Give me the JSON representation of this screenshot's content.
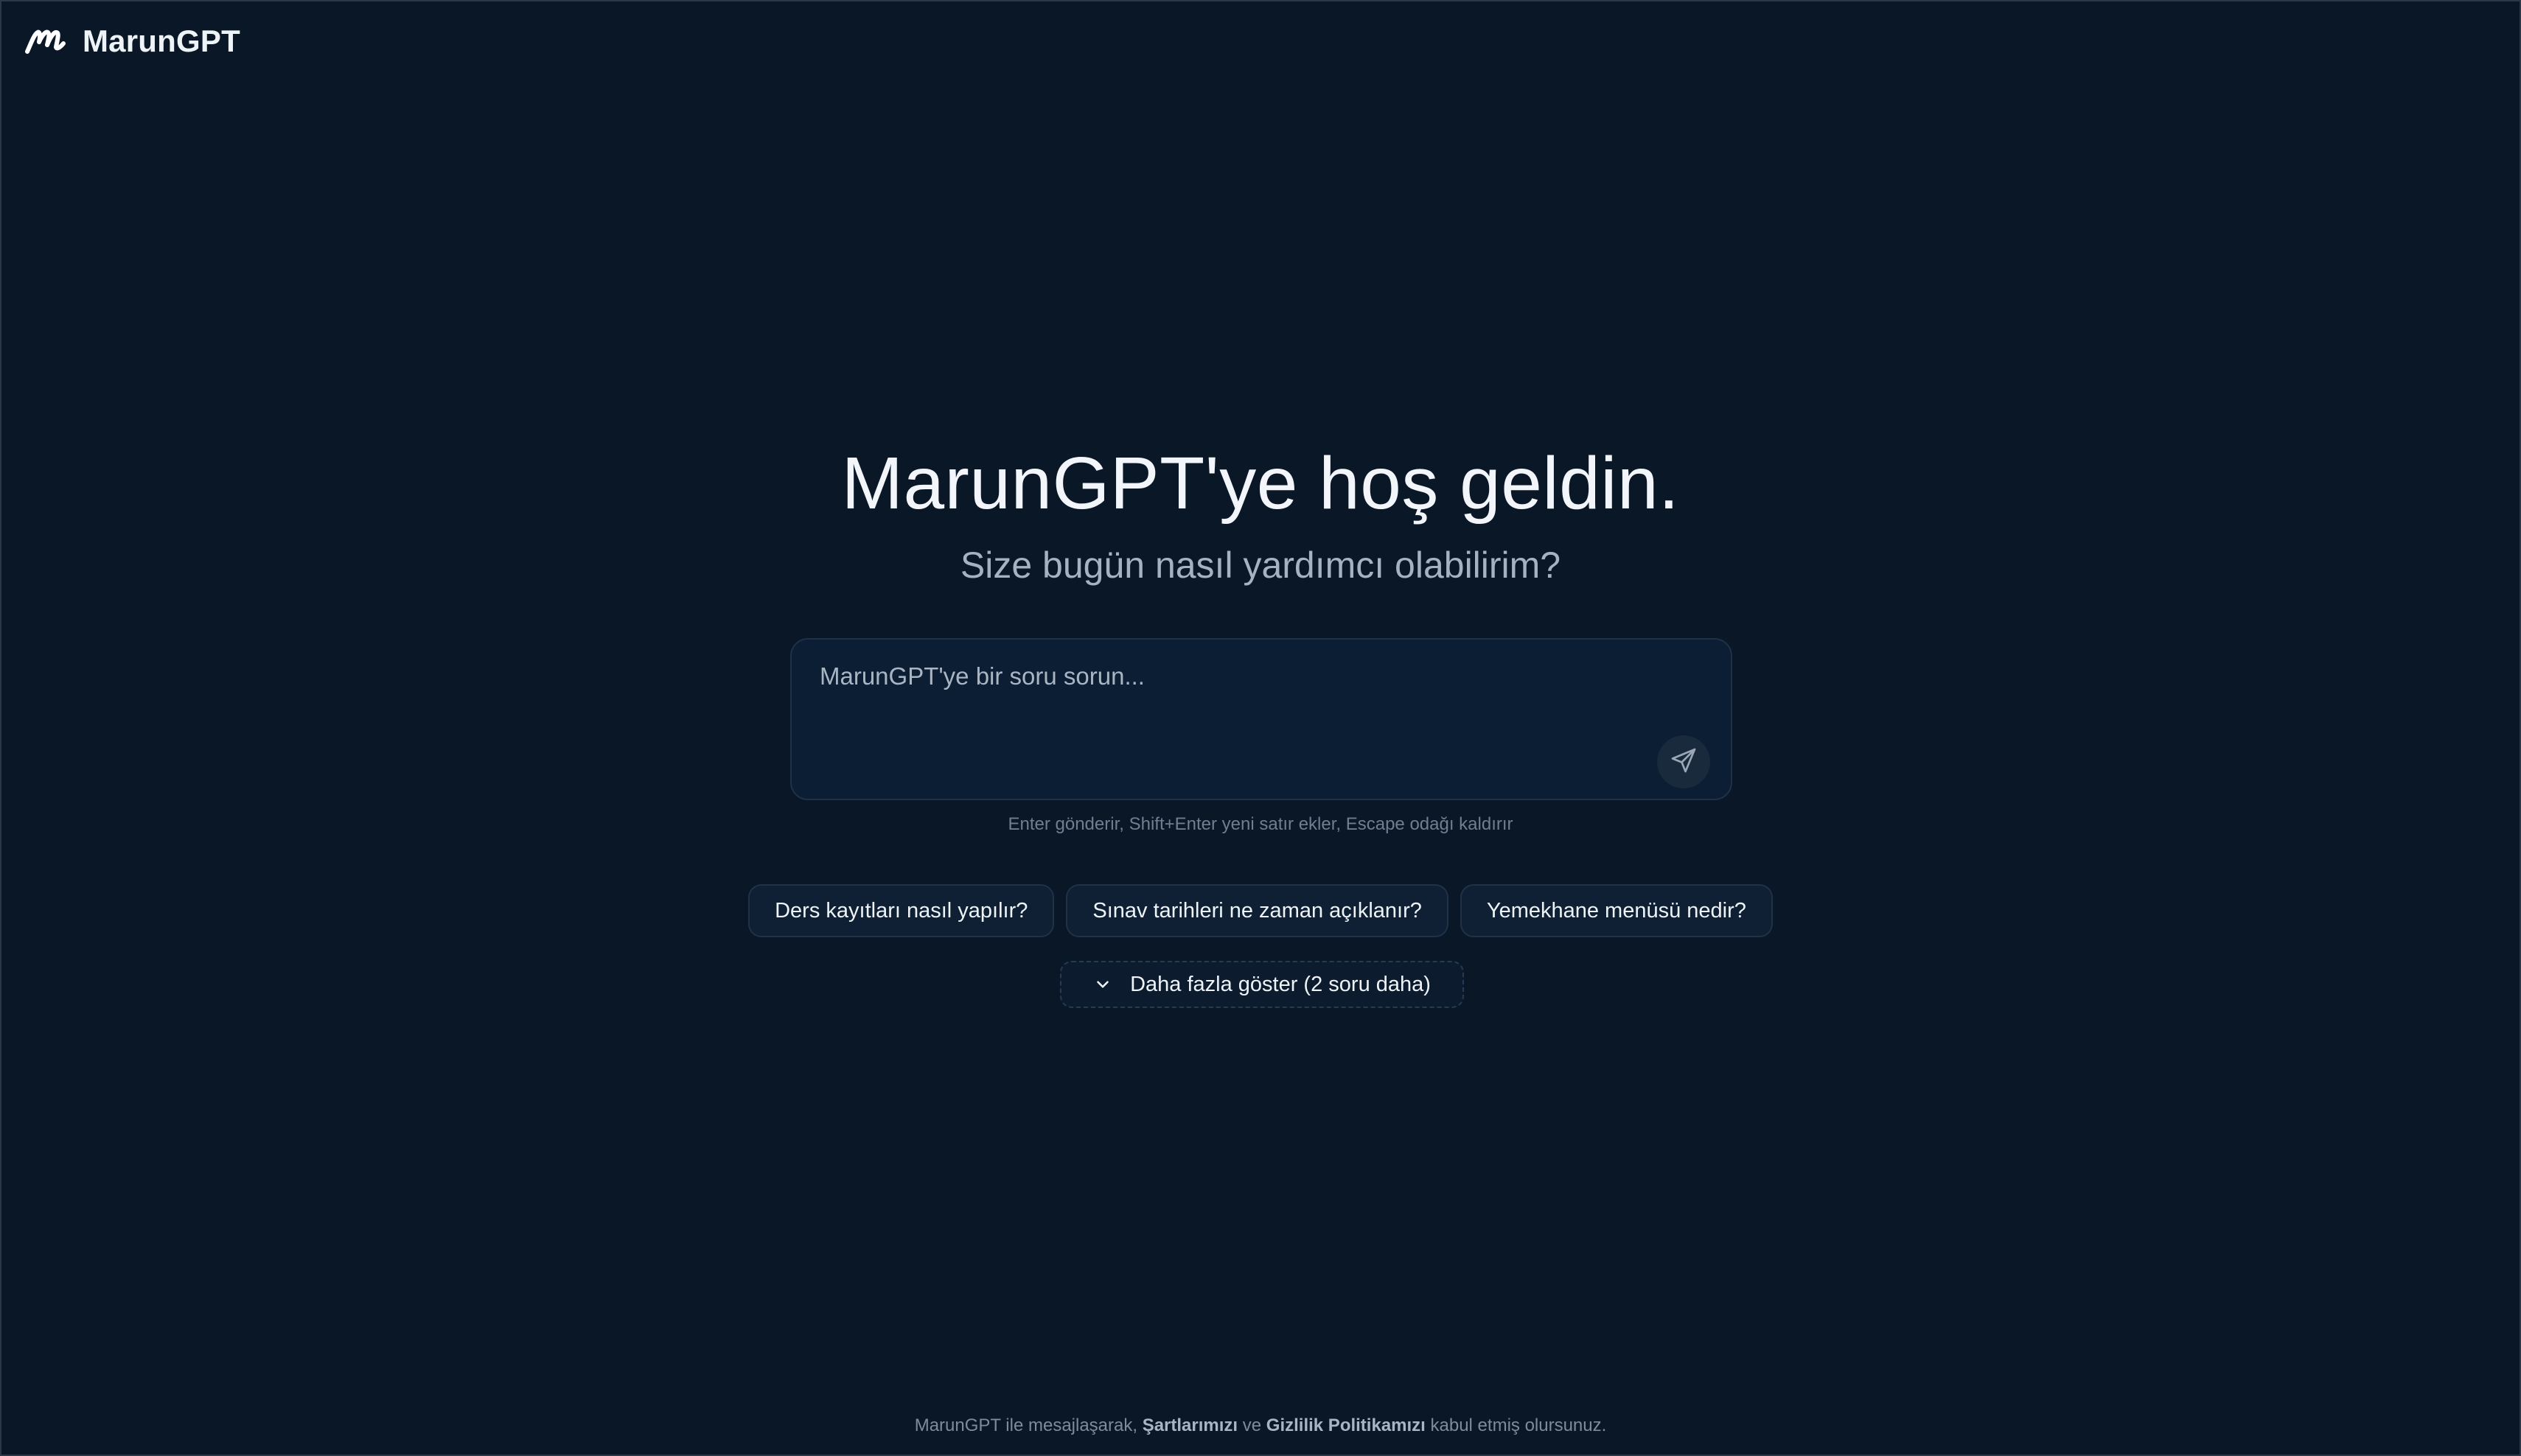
{
  "brand": {
    "name": "MarunGPT",
    "logo_icon": "marun-logo-icon"
  },
  "hero": {
    "title": "MarunGPT'ye hoş geldin.",
    "subtitle": "Size bugün nasıl yardımcı olabilirim?"
  },
  "composer": {
    "value": "",
    "placeholder": "MarunGPT'ye bir soru sorun...",
    "send_icon": "send-icon",
    "hint": "Enter gönderir, Shift+Enter yeni satır ekler, Escape odağı kaldırır"
  },
  "suggestions": [
    {
      "label": "Ders kayıtları nasıl yapılır?"
    },
    {
      "label": "Sınav tarihleri ne zaman açıklanır?"
    },
    {
      "label": "Yemekhane menüsü nedir?"
    }
  ],
  "show_more": {
    "label": "Daha fazla göster (2 soru daha)",
    "icon": "chevron-down-icon"
  },
  "footer": {
    "prefix": "MarunGPT ile mesajlaşarak, ",
    "terms_label": "Şartlarımızı",
    "middle": " ve ",
    "privacy_label": "Gizlilik Politikamızı",
    "suffix": " kabul etmiş olursunuz."
  },
  "colors": {
    "background": "#0a1727",
    "composer_bg": "#0c1e33",
    "chip_bg": "#0f2034",
    "text_primary": "#f2f6fa",
    "text_muted": "#a5b2c1"
  }
}
